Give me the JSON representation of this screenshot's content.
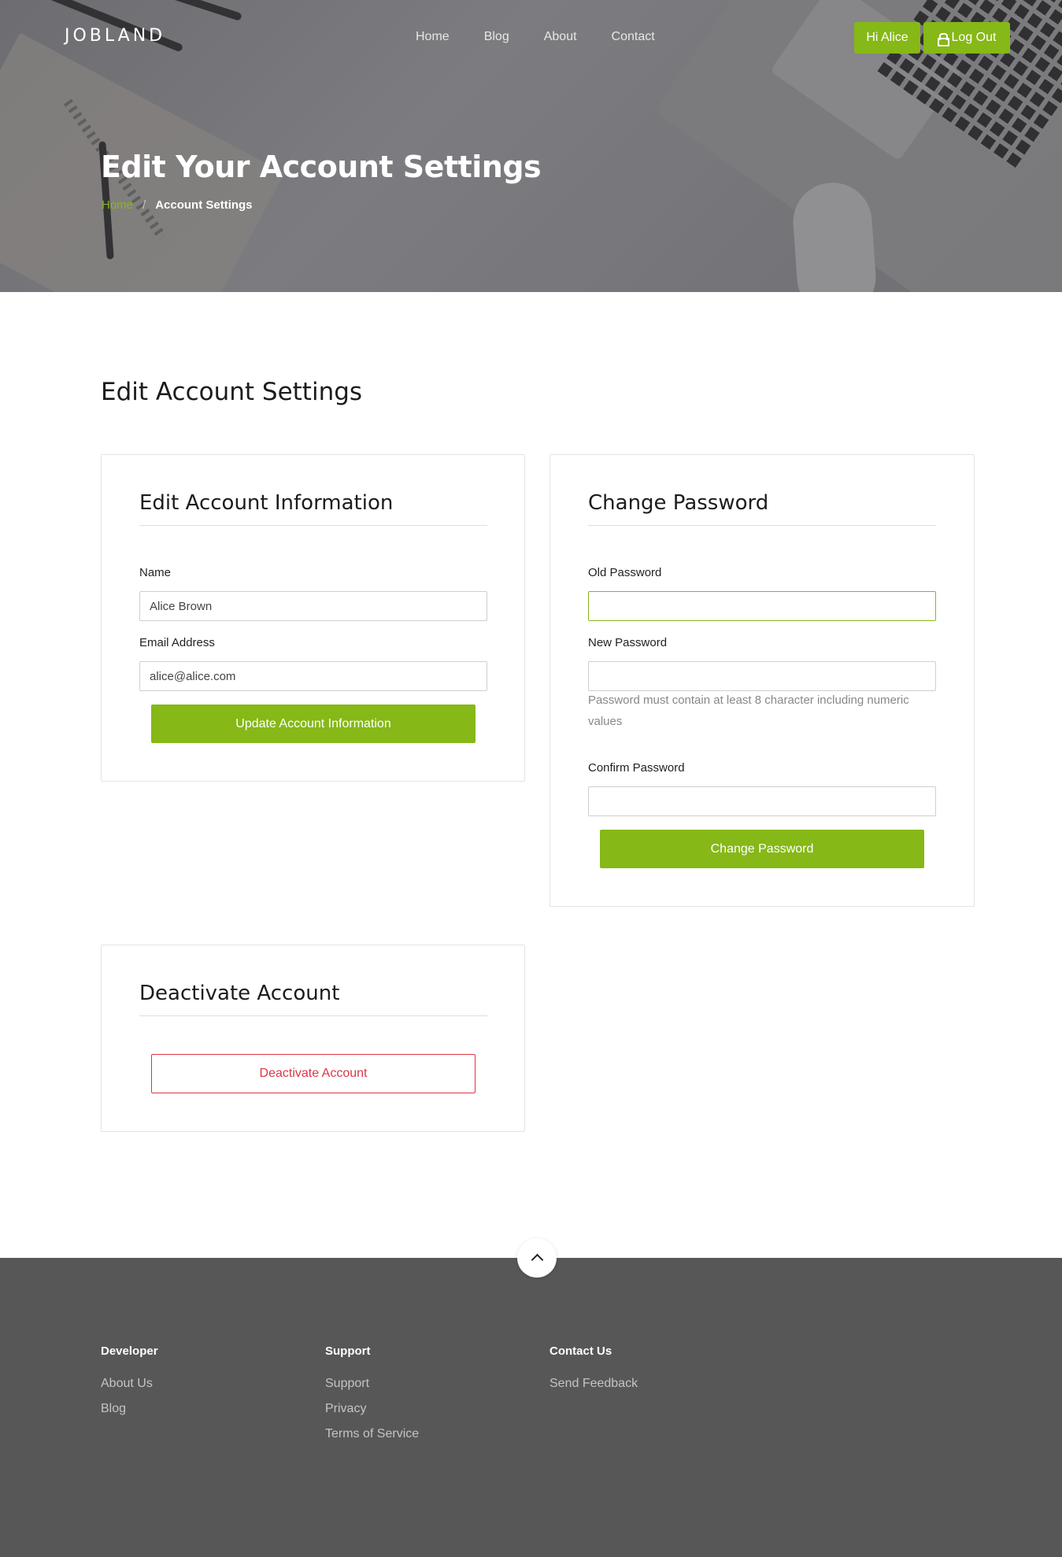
{
  "header": {
    "brand": "JOBLAND",
    "nav": [
      "Home",
      "Blog",
      "About",
      "Contact"
    ],
    "greeting_button": "Hi Alice",
    "logout_button": "Log Out",
    "accent_color": "#86b817"
  },
  "hero": {
    "title": "Edit Your Account Settings",
    "breadcrumb": {
      "home": "Home",
      "separator": "/",
      "current": "Account Settings"
    }
  },
  "main": {
    "section_title": "Edit Account Settings",
    "account_info": {
      "title": "Edit Account Information",
      "name_label": "Name",
      "name_value": "Alice Brown",
      "email_label": "Email Address",
      "email_value": "alice@alice.com",
      "submit": "Update Account Information"
    },
    "change_password": {
      "title": "Change Password",
      "old_label": "Old Password",
      "new_label": "New Password",
      "hint": "Password must contain at least 8 character including numeric values",
      "confirm_label": "Confirm Password",
      "submit": "Change Password"
    },
    "deactivate": {
      "title": "Deactivate Account",
      "button": "Deactivate Account",
      "danger_color": "#dc3545"
    }
  },
  "footer": {
    "columns": [
      {
        "heading": "Developer",
        "links": [
          "About Us",
          "Blog"
        ]
      },
      {
        "heading": "Support",
        "links": [
          "Support",
          "Privacy",
          "Terms of Service"
        ]
      },
      {
        "heading": "Contact Us",
        "links": [
          "Send Feedback"
        ]
      }
    ],
    "scroll_top_icon": "chevron-up-icon"
  }
}
